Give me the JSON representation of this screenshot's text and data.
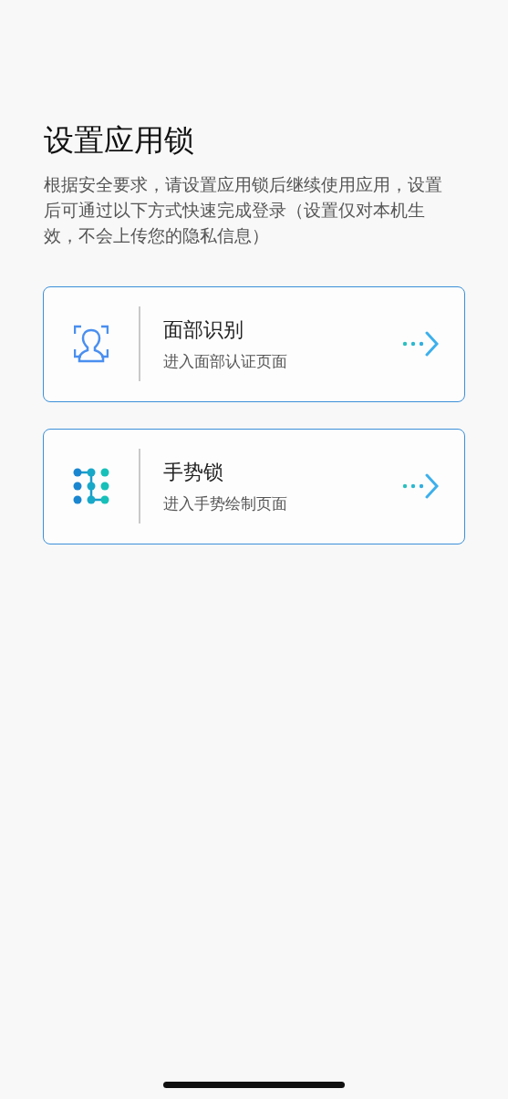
{
  "title": "设置应用锁",
  "description": "根据安全要求，请设置应用锁后继续使用应用，设置后可通过以下方式快速完成登录（设置仅对本机生效，不会上传您的隐私信息）",
  "options": [
    {
      "kind": "face",
      "title": "面部识别",
      "subtitle": "进入面部认证页面"
    },
    {
      "kind": "gesture",
      "title": "手势锁",
      "subtitle": "进入手势绘制页面"
    }
  ]
}
